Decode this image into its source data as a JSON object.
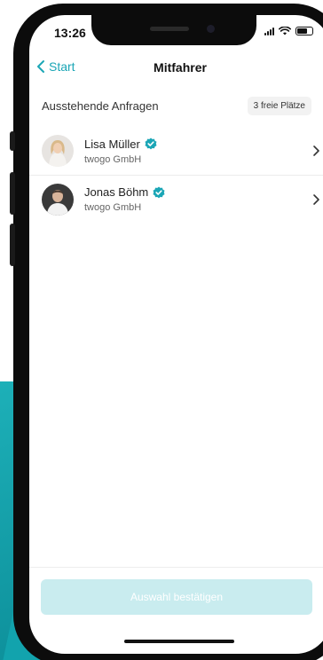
{
  "status_bar": {
    "time": "13:26"
  },
  "nav": {
    "back_label": "Start",
    "title": "Mitfahrer"
  },
  "section": {
    "title": "Ausstehende Anfragen",
    "free_seats_badge": "3 freie Plätze"
  },
  "requests": [
    {
      "name": "Lisa Müller",
      "company": "twogo GmbH",
      "verified": true
    },
    {
      "name": "Jonas Böhm",
      "company": "twogo GmbH",
      "verified": true
    }
  ],
  "footer": {
    "confirm_label": "Auswahl bestätigen",
    "confirm_enabled": false
  },
  "colors": {
    "accent": "#1ba6b6",
    "verified_badge": "#1ba6b6",
    "confirm_disabled": "#c9ecef"
  }
}
